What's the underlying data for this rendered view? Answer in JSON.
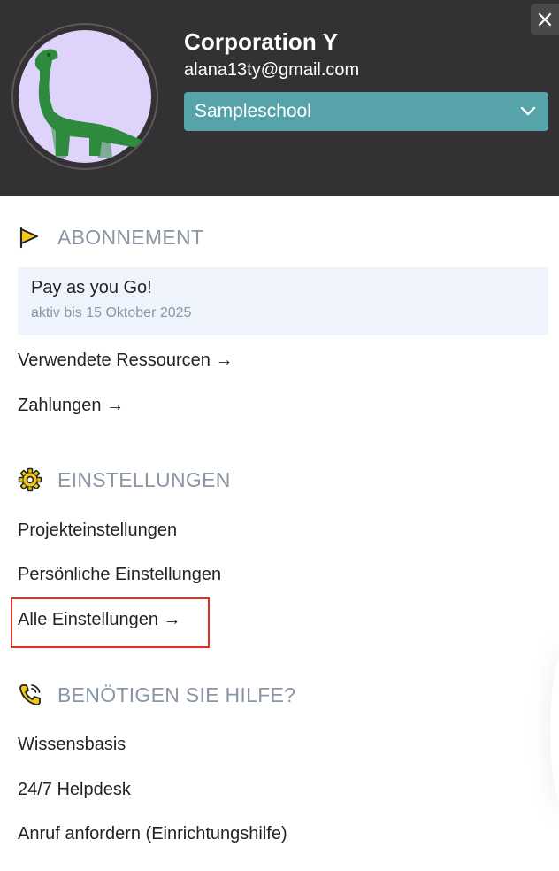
{
  "header": {
    "org_name": "Corporation Y",
    "email": "alana13ty@gmail.com",
    "school_select": {
      "selected": "Sampleschool"
    },
    "colors": {
      "background": "#333134",
      "select": "#56a3aa",
      "avatar_bg": "#ddd3fb",
      "dino": "#2e8b3e"
    }
  },
  "subscription": {
    "title": "ABONNEMENT",
    "icon": "flag-icon",
    "plan_name": "Pay as you Go!",
    "plan_status": "aktiv bis 15 Oktober 2025",
    "links": [
      "Verwendete Ressourcen →",
      "Zahlungen →"
    ]
  },
  "settings": {
    "title": "EINSTELLUNGEN",
    "icon": "gear-icon",
    "links": [
      "Projekteinstellungen",
      "Persönliche Einstellungen",
      "Alle Einstellungen →"
    ]
  },
  "help": {
    "title": "BENÖTIGEN SIE HILFE?",
    "icon": "phone-icon",
    "links": [
      "Wissensbasis",
      "24/7 Helpdesk",
      "Anruf anfordern (Einrichtungshilfe)"
    ]
  },
  "colors": {
    "section_title": "#8a96a3",
    "plan_box": "#eef3fc",
    "highlight": "#e0301e",
    "accent_yellow": "#f2c811"
  }
}
